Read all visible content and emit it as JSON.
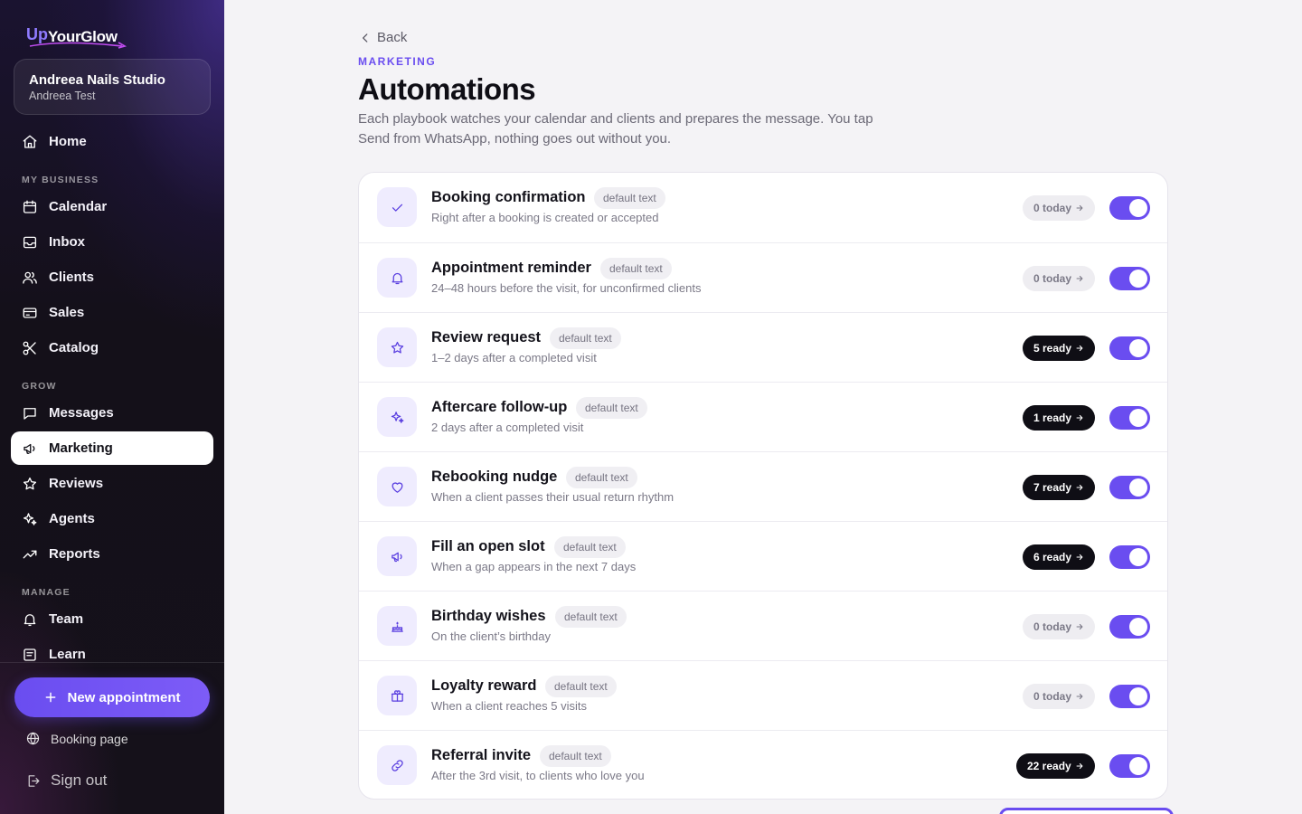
{
  "brand": {
    "logo_up": "Up",
    "logo_name": "YourGlow"
  },
  "studio": {
    "name": "Andreea Nails Studio",
    "user": "Andreea Test"
  },
  "nav": {
    "home": "Home",
    "section_business": "MY BUSINESS",
    "calendar": "Calendar",
    "inbox": "Inbox",
    "clients": "Clients",
    "sales": "Sales",
    "catalog": "Catalog",
    "section_grow": "GROW",
    "messages": "Messages",
    "marketing": "Marketing",
    "reviews": "Reviews",
    "agents": "Agents",
    "reports": "Reports",
    "section_manage": "MANAGE",
    "team": "Team",
    "learn": "Learn",
    "active": "Marketing"
  },
  "sidebar_footer": {
    "new_appointment": "New appointment",
    "booking_page": "Booking page",
    "sign_out": "Sign out"
  },
  "header": {
    "back": "Back",
    "eyebrow": "MARKETING",
    "title": "Automations",
    "description": "Each playbook watches your calendar and clients and prepares the message. You tap Send from WhatsApp, nothing goes out without you."
  },
  "automations": [
    {
      "title": "Booking confirmation",
      "tag": "default text",
      "subtitle": "Right after a booking is created or accepted",
      "status": "0 today",
      "status_kind": "idle",
      "enabled": true,
      "icon": "check-icon"
    },
    {
      "title": "Appointment reminder",
      "tag": "default text",
      "subtitle": "24–48 hours before the visit, for unconfirmed clients",
      "status": "0 today",
      "status_kind": "idle",
      "enabled": true,
      "icon": "bell-icon"
    },
    {
      "title": "Review request",
      "tag": "default text",
      "subtitle": "1–2 days after a completed visit",
      "status": "5 ready",
      "status_kind": "ready",
      "enabled": true,
      "icon": "star-icon"
    },
    {
      "title": "Aftercare follow-up",
      "tag": "default text",
      "subtitle": "2 days after a completed visit",
      "status": "1 ready",
      "status_kind": "ready",
      "enabled": true,
      "icon": "sparkles-icon"
    },
    {
      "title": "Rebooking nudge",
      "tag": "default text",
      "subtitle": "When a client passes their usual return rhythm",
      "status": "7 ready",
      "status_kind": "ready",
      "enabled": true,
      "icon": "heart-icon"
    },
    {
      "title": "Fill an open slot",
      "tag": "default text",
      "subtitle": "When a gap appears in the next 7 days",
      "status": "6 ready",
      "status_kind": "ready",
      "enabled": true,
      "icon": "megaphone-icon"
    },
    {
      "title": "Birthday wishes",
      "tag": "default text",
      "subtitle": "On the client’s birthday",
      "status": "0 today",
      "status_kind": "idle",
      "enabled": true,
      "icon": "cake-icon"
    },
    {
      "title": "Loyalty reward",
      "tag": "default text",
      "subtitle": "When a client reaches 5 visits",
      "status": "0 today",
      "status_kind": "idle",
      "enabled": true,
      "icon": "gift-icon"
    },
    {
      "title": "Referral invite",
      "tag": "default text",
      "subtitle": "After the 3rd visit, to clients who love you",
      "status": "22 ready",
      "status_kind": "ready",
      "enabled": true,
      "icon": "link-icon"
    }
  ],
  "colors": {
    "accent": "#6a4df0",
    "accent_soft": "#efecfe",
    "ready_pill": "#0f0e15",
    "sidebar_bg": "#141019"
  }
}
